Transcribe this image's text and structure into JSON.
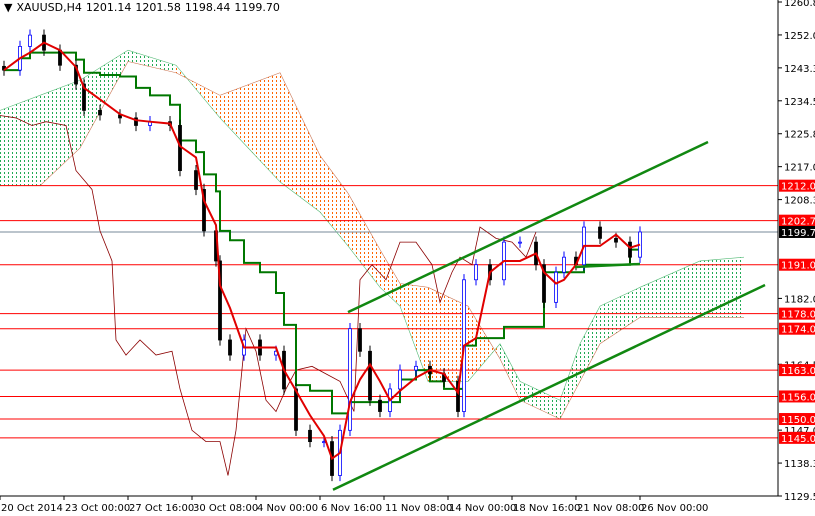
{
  "header": {
    "symbol": "XAUUSD,H4",
    "open": "1201.14",
    "high": "1201.58",
    "low": "1198.44",
    "close": "1199.70"
  },
  "chart_data": {
    "type": "candlestick",
    "title": "XAUUSD,H4",
    "ylim": [
      1129.55,
      1260.8
    ],
    "y_ticks": [
      "1260.80",
      "1252.05",
      "1243.30",
      "1234.55",
      "1225.80",
      "1217.05",
      "1208.30",
      "1182.05",
      "1164.55",
      "1147.05",
      "1138.30",
      "1129.55"
    ],
    "x_ticks": [
      {
        "bar": 0,
        "label": "20 Oct 2014"
      },
      {
        "bar": 16,
        "label": "23 Oct 00:00"
      },
      {
        "bar": 32,
        "label": "27 Oct 16:00"
      },
      {
        "bar": 48,
        "label": "30 Oct 08:00"
      },
      {
        "bar": 64,
        "label": "4 Nov 00:00"
      },
      {
        "bar": 80,
        "label": "6 Nov 16:00"
      },
      {
        "bar": 96,
        "label": "11 Nov 08:00"
      },
      {
        "bar": 112,
        "label": "14 Nov 00:00"
      },
      {
        "bar": 128,
        "label": "18 Nov 16:00"
      },
      {
        "bar": 144,
        "label": "21 Nov 08:00"
      },
      {
        "bar": 160,
        "label": "26 Nov 00:00"
      }
    ],
    "price": [
      [
        1,
        1242.7
      ],
      [
        5,
        1249
      ],
      [
        7.5,
        1252
      ],
      [
        11,
        1248
      ],
      [
        15,
        1244
      ],
      [
        19,
        1239
      ],
      [
        21,
        1232
      ],
      [
        25,
        1230.8
      ],
      [
        30,
        1230
      ],
      [
        34,
        1228
      ],
      [
        37.5,
        1229
      ],
      [
        42.5,
        1228
      ],
      [
        45,
        1216
      ],
      [
        49,
        1211
      ],
      [
        51,
        1200
      ],
      [
        54,
        1192
      ],
      [
        55,
        1171
      ],
      [
        57.5,
        1167
      ],
      [
        61,
        1171
      ],
      [
        65,
        1167
      ],
      [
        69,
        1168
      ],
      [
        71,
        1158
      ],
      [
        74,
        1147
      ],
      [
        77.5,
        1144
      ],
      [
        81,
        1144
      ],
      [
        83,
        1135
      ],
      [
        85,
        1147
      ],
      [
        87.5,
        1174
      ],
      [
        90,
        1168
      ],
      [
        92.5,
        1155
      ],
      [
        95,
        1152
      ],
      [
        97.5,
        1158
      ],
      [
        100,
        1163
      ],
      [
        104,
        1164
      ],
      [
        107.5,
        1162
      ],
      [
        111,
        1160
      ],
      [
        114.5,
        1152
      ],
      [
        116,
        1187
      ],
      [
        119,
        1191
      ],
      [
        122.5,
        1187
      ],
      [
        126,
        1197
      ],
      [
        130,
        1197
      ],
      [
        134,
        1191
      ],
      [
        136,
        1181
      ],
      [
        139,
        1189
      ],
      [
        141,
        1193
      ],
      [
        144,
        1191
      ],
      [
        146,
        1201
      ],
      [
        150,
        1198
      ],
      [
        154,
        1197
      ],
      [
        157.5,
        1193
      ],
      [
        160,
        1199.7
      ]
    ],
    "cloud": [
      [
        0,
        1232,
        1212
      ],
      [
        10,
        1236,
        1212
      ],
      [
        20,
        1240,
        1222
      ],
      [
        32,
        1248,
        1245
      ],
      [
        44,
        1244,
        1242
      ],
      [
        55,
        1230,
        1236
      ],
      [
        70,
        1213,
        1242
      ],
      [
        80,
        1205,
        1220
      ],
      [
        87,
        1196,
        1210
      ],
      [
        95,
        1185,
        1195
      ],
      [
        100,
        1180,
        1186
      ],
      [
        107,
        1160,
        1185
      ],
      [
        117,
        1160,
        1180
      ],
      [
        125,
        1170,
        1166
      ],
      [
        130,
        1160,
        1155
      ],
      [
        140,
        1155,
        1150
      ],
      [
        145,
        1170,
        1160
      ],
      [
        150,
        1180,
        1170
      ],
      [
        160,
        1185,
        1177
      ],
      [
        175,
        1192,
        1177
      ],
      [
        186,
        1193,
        1177
      ]
    ],
    "levels": [
      {
        "price": 1212.0,
        "label": "1212.00",
        "color": "#ff0000"
      },
      {
        "price": 1202.7,
        "label": "1202.70",
        "color": "#ff0000"
      },
      {
        "price": 1199.7,
        "label": "1199.70",
        "color": "#000000"
      },
      {
        "price": 1191.0,
        "label": "1191.00",
        "color": "#ff0000"
      },
      {
        "price": 1178.0,
        "label": "1178.00",
        "color": "#ff0000"
      },
      {
        "price": 1174.0,
        "label": "1174.00",
        "color": "#ff0000"
      },
      {
        "price": 1163.0,
        "label": "1163.00",
        "color": "#ff0000"
      },
      {
        "price": 1156.0,
        "label": "1156.00",
        "color": "#ff0000"
      },
      {
        "price": 1150.0,
        "label": "1150.00",
        "color": "#ff0000"
      },
      {
        "price": 1145.0,
        "label": "1145.00",
        "color": "#ff0000"
      }
    ],
    "trendlines": [
      {
        "name": "upper-channel",
        "from": [
          87,
          1178.4
        ],
        "to": [
          177,
          1223.6
        ]
      },
      {
        "name": "lower-channel",
        "from": [
          83.25,
          1131.2
        ],
        "to": [
          191.25,
          1185.6
        ]
      },
      {
        "name": "support-segment",
        "from": [
          143.75,
          1190.4
        ],
        "to": [
          160,
          1191.2
        ]
      }
    ],
    "colors": {
      "up": "#0000ff",
      "down": "#000000",
      "tenkan": "#e00000",
      "kijun": "#007700",
      "chikou": "#8b0000",
      "cloud_bull": "#22aa55",
      "cloud_bear": "#ff6600",
      "trend": "#118811"
    }
  }
}
